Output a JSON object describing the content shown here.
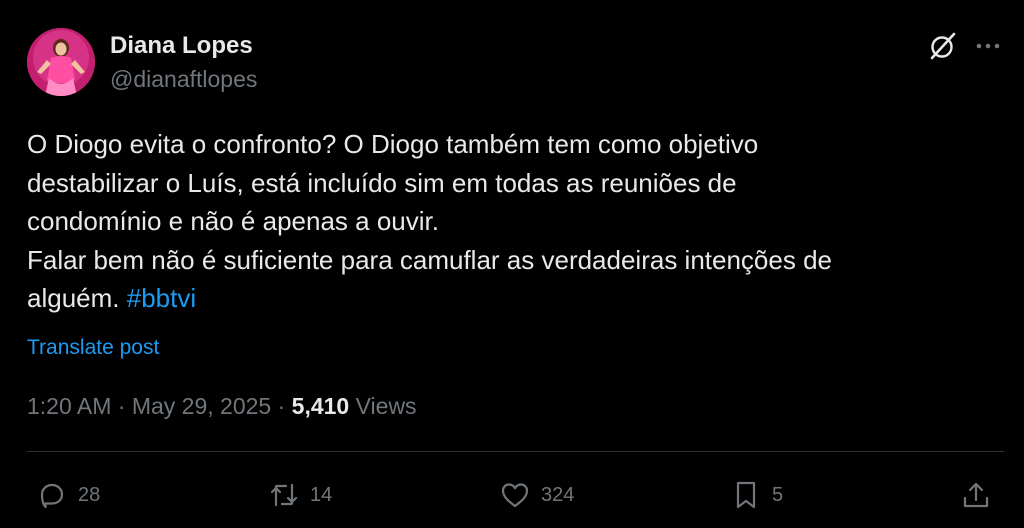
{
  "author": {
    "display_name": "Diana Lopes",
    "handle": "@dianaftlopes",
    "avatar_icon": "profile-photo-woman-pink-dress"
  },
  "header_icons": {
    "grok": "grok-icon",
    "more": "more-icon"
  },
  "post": {
    "lines": [
      "O Diogo evita o confronto? O Diogo também tem como objetivo",
      "destabilizar o Luís, está incluído sim em todas as reuniões de",
      "condomínio e não é apenas a ouvir.",
      "Falar bem não é suficiente para camuflar as verdadeiras intenções de"
    ],
    "last_line_text": "alguém.",
    "hashtag": "#bbtvi",
    "translate_label": "Translate post"
  },
  "meta": {
    "time": "1:20 AM",
    "separator1": "·",
    "date": "May 29, 2025",
    "separator2": "·",
    "views_count": "5,410",
    "views_label": "Views"
  },
  "actions": {
    "replies": "28",
    "reposts": "14",
    "likes": "324",
    "bookmarks": "5"
  },
  "colors": {
    "background": "#000000",
    "text": "#e7e9ea",
    "secondary": "#71767b",
    "accent": "#1d9bf0",
    "divider": "#2f3336"
  }
}
